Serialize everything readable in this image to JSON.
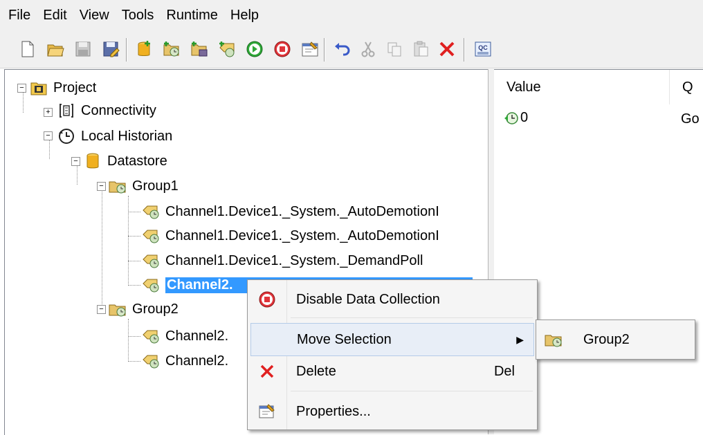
{
  "menu": [
    "File",
    "Edit",
    "View",
    "Tools",
    "Runtime",
    "Help"
  ],
  "toolbar": {
    "icons": [
      "new-icon",
      "open-icon",
      "save-icon",
      "save-as-icon",
      "new-datastore-icon",
      "new-group-icon",
      "add-items-icon",
      "item-icon",
      "start-icon",
      "stop-icon",
      "properties-icon",
      "undo-icon",
      "cut-icon",
      "copy-icon",
      "paste-icon",
      "delete-icon",
      "quick-client-icon"
    ],
    "quick_client_label": "QC"
  },
  "tree": {
    "project": "Project",
    "connectivity": "Connectivity",
    "local_historian": "Local Historian",
    "datastore": "Datastore",
    "group1": "Group1",
    "group1_items": [
      "Channel1.Device1._System._AutoDemotionI",
      "Channel1.Device1._System._AutoDemotionI",
      "Channel1.Device1._System._DemandPoll",
      "Channel2."
    ],
    "group2": "Group2",
    "group2_items": [
      "Channel2.",
      "Channel2."
    ]
  },
  "detail": {
    "columns": [
      "Value",
      "Q"
    ],
    "row": {
      "value": "0",
      "quality": "Go"
    }
  },
  "context_menu": {
    "items": [
      {
        "label": "Disable Data Collection",
        "icon": "stop-circle-icon"
      },
      {
        "label": "Move Selection",
        "icon": "",
        "has_submenu": true
      },
      {
        "label": "Delete",
        "icon": "delete-x-icon",
        "shortcut": "Del"
      },
      {
        "label": "Properties...",
        "icon": "properties-icon"
      }
    ]
  },
  "submenu": {
    "items": [
      {
        "label": "Group2",
        "icon": "group-icon"
      }
    ]
  },
  "colors": {
    "selection": "#3399ff",
    "menu_bg": "#f5f5f5",
    "toolbar_bg": "#f0f0f0"
  }
}
